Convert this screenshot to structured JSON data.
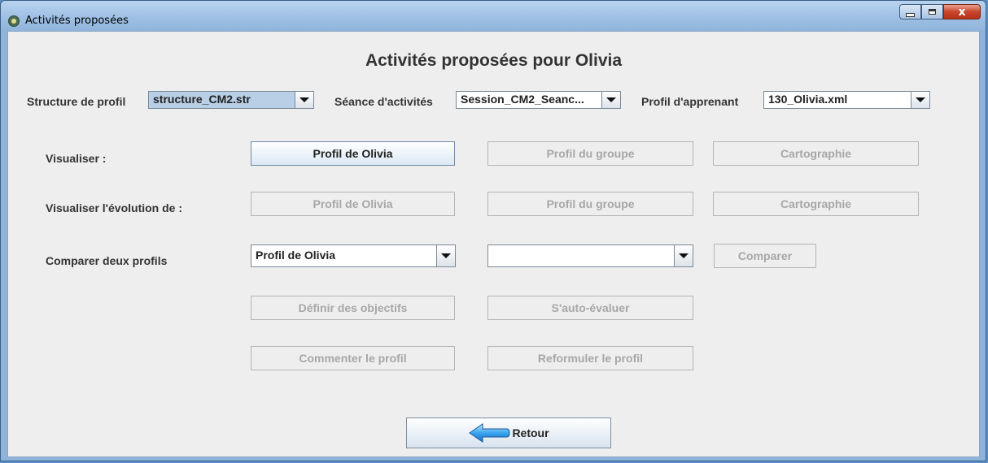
{
  "window": {
    "title": "Activités proposées",
    "close_glyph": "x"
  },
  "heading": "Activités proposées pour Olivia",
  "selectors": {
    "structure_label": "Structure de profil",
    "structure_value": "structure_CM2.str",
    "seance_label": "Séance d'activités",
    "seance_value": "Session_CM2_Seanc...",
    "profil_label": "Profil d'apprenant",
    "profil_value": "130_Olivia.xml"
  },
  "visualiser": {
    "label": "Visualiser :",
    "buttons": [
      "Profil de Olivia",
      "Profil du groupe",
      "Cartographie"
    ]
  },
  "evolution": {
    "label": "Visualiser l'évolution de :",
    "buttons": [
      "Profil de Olivia",
      "Profil du groupe",
      "Cartographie"
    ]
  },
  "comparer": {
    "label": "Comparer deux profils",
    "first_value": "Profil de Olivia",
    "second_value": "",
    "button": "Comparer"
  },
  "actions": {
    "objectifs": "Définir des objectifs",
    "auto_evaluer": "S'auto-évaluer",
    "commenter": "Commenter le profil",
    "reformuler": "Reformuler le profil"
  },
  "retour": {
    "label": "Retour",
    "icon": "back-arrow-icon"
  }
}
